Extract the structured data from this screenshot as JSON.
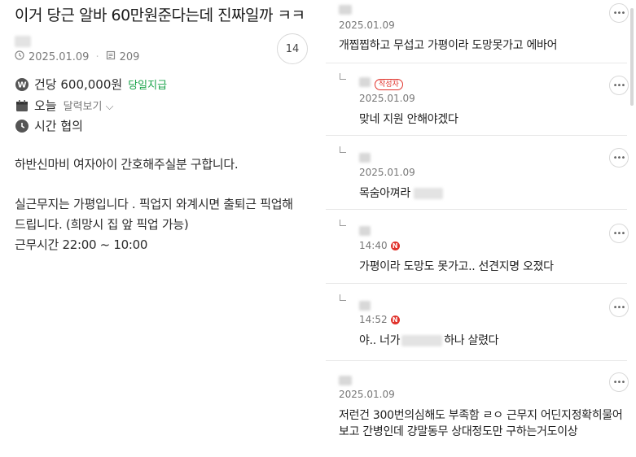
{
  "post": {
    "title": "이거 당근 알바 60만원준다는데 진짜일까 ㅋㅋ",
    "date": "2025.01.09",
    "views": "209",
    "comment_count": "14",
    "pay": "건당 600,000원",
    "pay_tag": "당일지급",
    "day": "오늘",
    "calendar_link": "달력보기",
    "time": "시간 협의",
    "body": [
      "하반신마비 여자아이 간호해주실분 구합니다.",
      "",
      "실근무지는 가평입니다 . 픽업지 와계시면 출퇴근 픽업해",
      "드립니다. (희망시 집 앞 픽업 가능)",
      "근무시간 22:00 ~ 10:00"
    ]
  },
  "comments": [
    {
      "date": "2025.01.09",
      "text": "개찝찝하고 무섭고 가평이라 도망못가고 에바어"
    },
    {
      "badge": "작성자",
      "date": "2025.01.09",
      "text": "맞네 지원 안해야겠다"
    },
    {
      "date": "2025.01.09",
      "text_before": "목숨아껴라",
      "text_after": ""
    },
    {
      "date": "14:40",
      "new_badge": "N",
      "text": "가평이라 도망도 못가고.. 선견지명 오졌다"
    },
    {
      "date": "14:52",
      "new_badge": "N",
      "text_before": "야.. 너가",
      "text_after": "하나 살렸다"
    },
    {
      "date": "2025.01.09",
      "text_lines": [
        "저런건 300번의심해도 부족함 ㄹㅇ 근무지 어딘지정확히물어",
        "보고 간병인데 걍말동무 상대정도만 구하는거도이상"
      ]
    }
  ],
  "colors": {
    "accent_green": "#1aa34a",
    "new_red": "#e0322b"
  }
}
